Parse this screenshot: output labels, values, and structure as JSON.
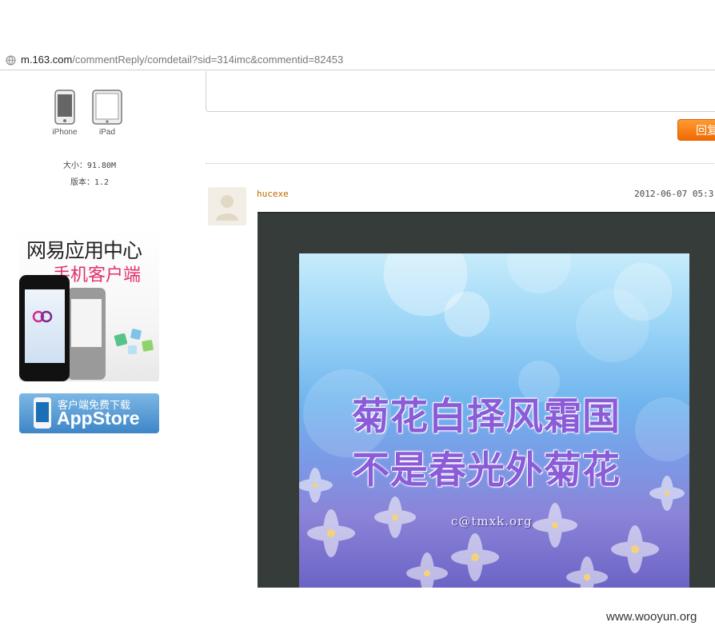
{
  "browser": {
    "url_host": "m.163.com",
    "url_path": "/commentReply/comdetail?sid=314imc&commentid=82453"
  },
  "sidebar": {
    "devices": [
      {
        "label": "iPhone",
        "icon": "iphone-icon"
      },
      {
        "label": "iPad",
        "icon": "ipad-icon"
      }
    ],
    "size_text": "大小：91.80M",
    "version_text": "版本：1.2",
    "promo": {
      "title": "网易应用中心",
      "subtitle": "手机客户端",
      "accent": "#e1306c"
    },
    "appstore": {
      "small_text": "客户端免费下载",
      "big_text": "AppStore",
      "color": "#3d86c8"
    }
  },
  "reply": {
    "button_label": "回复",
    "button_color": "#f06a00"
  },
  "comment": {
    "username": "hucexe",
    "datetime": "2012-06-07 05:3",
    "image": {
      "line1": "菊花白择风霜国",
      "line2": "不是春光外菊花",
      "credit": "c@tmxk.org"
    }
  },
  "watermark": "www.wooyun.org"
}
